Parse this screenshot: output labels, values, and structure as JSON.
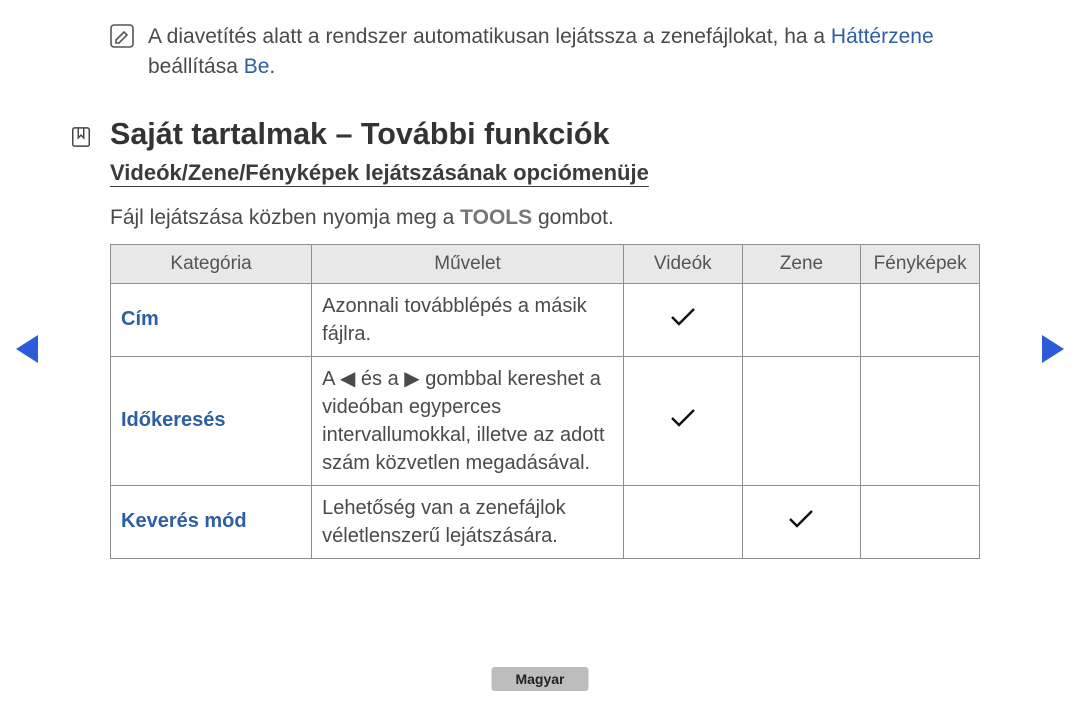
{
  "note": {
    "text_before": "A diavetítés alatt a rendszer automatikusan lejátssza a zenefájlokat, ha a ",
    "highlight1": "Háttérzene",
    "mid": " beállítása ",
    "highlight2": "Be",
    "after": "."
  },
  "section_title": "Saját tartalmak – További funkciók",
  "sub_title": "Videók/Zene/Fényképek lejátszásának opciómenüje",
  "instruction_before": "Fájl lejátszása közben nyomja meg a ",
  "instruction_tools": "TOOLS",
  "instruction_after": " gombot.",
  "table": {
    "headers": [
      "Kategória",
      "Művelet",
      "Videók",
      "Zene",
      "Fényképek"
    ],
    "rows": [
      {
        "category": "Cím",
        "operation": "Azonnali továbblépés a másik fájlra.",
        "videok": true,
        "zene": false,
        "fenykepek": false
      },
      {
        "category": "Időkeresés",
        "operation": "A ◄ és a ► gombbal kereshet a videóban egyperces intervallumokkal, illetve az adott szám közvetlen megadásával.",
        "videok": true,
        "zene": false,
        "fenykepek": false
      },
      {
        "category": "Keverés mód",
        "operation": "Lehetőség van a zenefájlok véletlenszerű lejátszására.",
        "videok": false,
        "zene": true,
        "fenykepek": false
      }
    ]
  },
  "lang_badge": "Magyar"
}
